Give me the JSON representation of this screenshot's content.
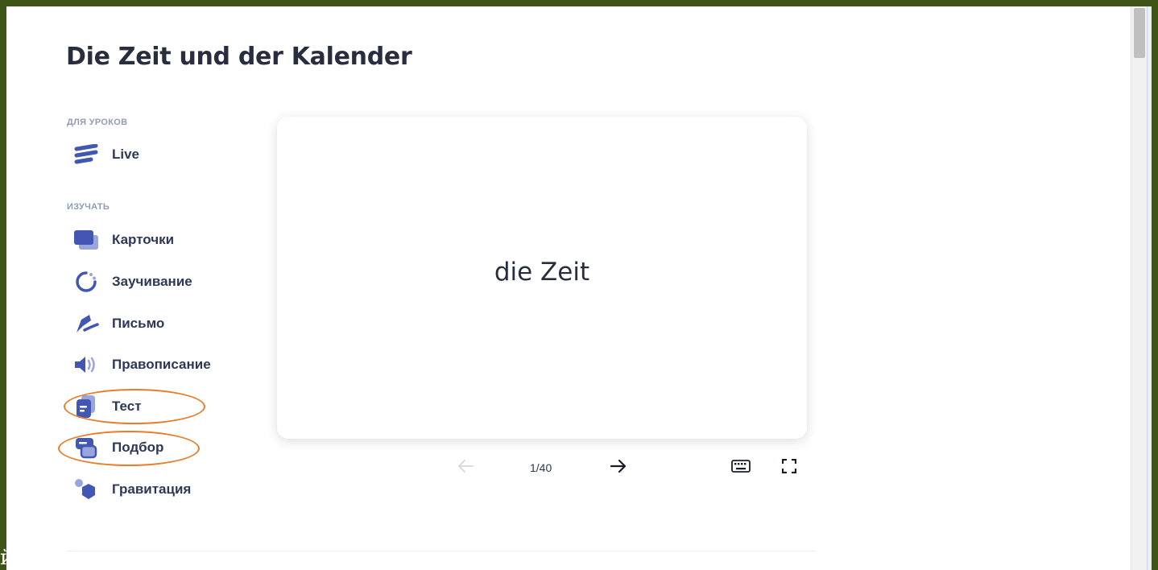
{
  "page": {
    "title": "Die Zeit und der Kalender",
    "corner_glyph": "й"
  },
  "sidebar": {
    "sections": [
      {
        "label": "ДЛЯ УРОКОВ",
        "items": [
          {
            "label": "Live",
            "icon": "live-stripes-icon"
          }
        ]
      },
      {
        "label": "ИЗУЧАТЬ",
        "items": [
          {
            "label": "Карточки",
            "icon": "flashcards-icon"
          },
          {
            "label": "Заучивание",
            "icon": "learn-cycle-icon"
          },
          {
            "label": "Письмо",
            "icon": "pen-icon"
          },
          {
            "label": "Правописание",
            "icon": "speaker-icon"
          },
          {
            "label": "Тест",
            "icon": "test-document-icon",
            "highlighted": true
          },
          {
            "label": "Подбор",
            "icon": "match-icon",
            "highlighted": true
          },
          {
            "label": "Гравитация",
            "icon": "gravity-icon"
          }
        ]
      }
    ]
  },
  "card": {
    "term": "die Zeit"
  },
  "controls": {
    "counter": "1/40",
    "prev_icon": "arrow-left-icon",
    "next_icon": "arrow-right-icon",
    "keyboard_icon": "keyboard-icon",
    "fullscreen_icon": "fullscreen-icon"
  },
  "colors": {
    "brand": "#4257b2",
    "brand_light": "#98a6dd",
    "text": "#2e3856",
    "highlight_ring": "#e87d2a",
    "muted": "#939bb4",
    "frame": "#3f5417"
  }
}
